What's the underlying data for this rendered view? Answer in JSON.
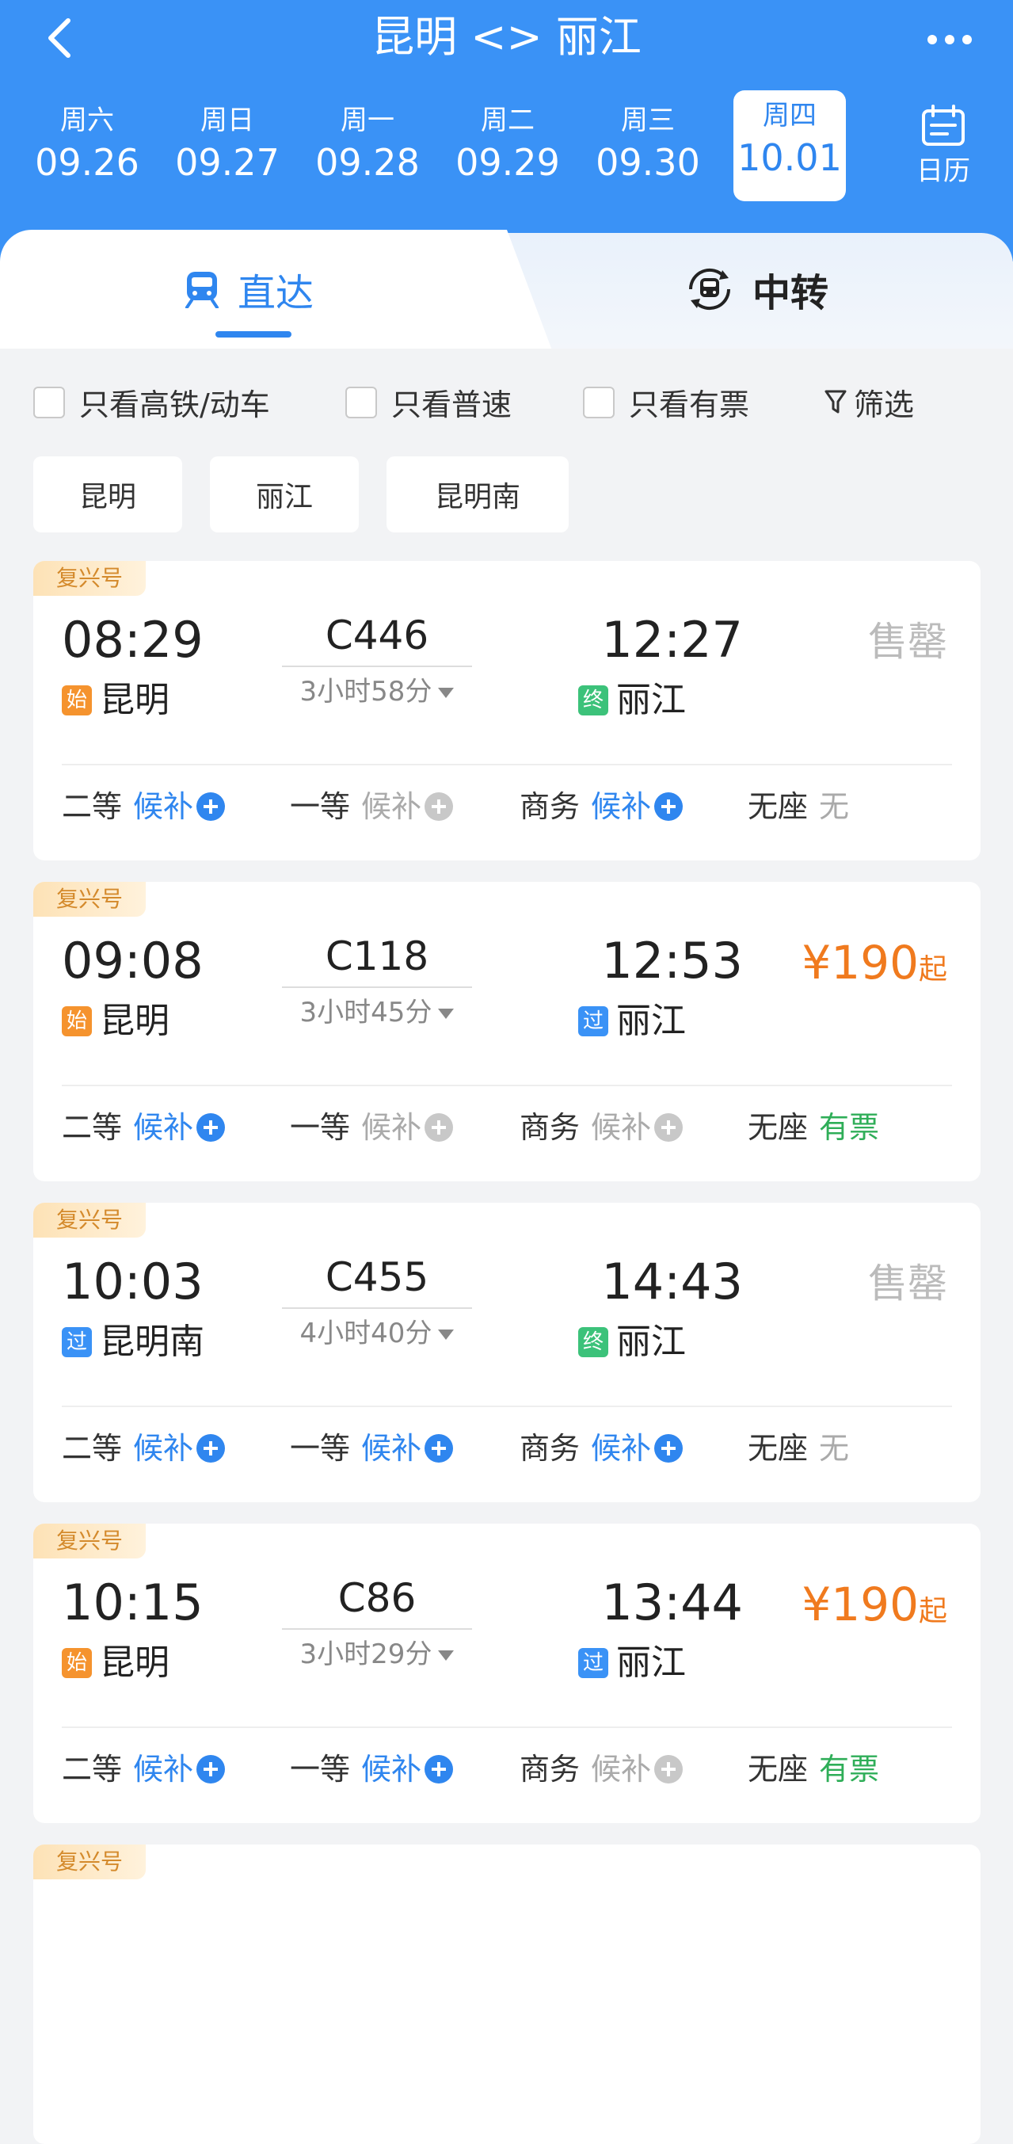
{
  "header": {
    "title": "昆明 <> 丽江",
    "dates": [
      {
        "weekday": "周六",
        "date": "09.26"
      },
      {
        "weekday": "周日",
        "date": "09.27"
      },
      {
        "weekday": "周一",
        "date": "09.28"
      },
      {
        "weekday": "周二",
        "date": "09.29"
      },
      {
        "weekday": "周三",
        "date": "09.30"
      },
      {
        "weekday": "周四",
        "date": "10.01"
      }
    ],
    "calendar_label": "日历"
  },
  "tabs": {
    "direct": "直达",
    "transfer": "中转"
  },
  "filters": {
    "high_speed": "只看高铁/动车",
    "normal": "只看普速",
    "available": "只看有票",
    "filter": "筛选"
  },
  "stations": [
    "昆明",
    "丽江",
    "昆明南"
  ],
  "trains": [
    {
      "badge": "复兴号",
      "dep_time": "08:29",
      "train_no": "C446",
      "duration": "3小时58分",
      "arr_time": "12:27",
      "from_tag": "始",
      "from": "昆明",
      "to_tag": "终",
      "to": "丽江",
      "price": "",
      "price_suffix": "",
      "status": "售罄",
      "seats": [
        {
          "class": "二等",
          "value": "候补"
        },
        {
          "class": "一等",
          "value": "候补"
        },
        {
          "class": "商务",
          "value": "候补"
        },
        {
          "class": "无座",
          "value": "无"
        }
      ]
    },
    {
      "badge": "复兴号",
      "dep_time": "09:08",
      "train_no": "C118",
      "duration": "3小时45分",
      "arr_time": "12:53",
      "from_tag": "始",
      "from": "昆明",
      "to_tag": "过",
      "to": "丽江",
      "price": "¥190",
      "price_suffix": "起",
      "status": "",
      "seats": [
        {
          "class": "二等",
          "value": "候补"
        },
        {
          "class": "一等",
          "value": "候补"
        },
        {
          "class": "商务",
          "value": "候补"
        },
        {
          "class": "无座",
          "value": "有票"
        }
      ]
    },
    {
      "badge": "复兴号",
      "dep_time": "10:03",
      "train_no": "C455",
      "duration": "4小时40分",
      "arr_time": "14:43",
      "from_tag": "过",
      "from": "昆明南",
      "to_tag": "终",
      "to": "丽江",
      "price": "",
      "price_suffix": "",
      "status": "售罄",
      "seats": [
        {
          "class": "二等",
          "value": "候补"
        },
        {
          "class": "一等",
          "value": "候补"
        },
        {
          "class": "商务",
          "value": "候补"
        },
        {
          "class": "无座",
          "value": "无"
        }
      ]
    },
    {
      "badge": "复兴号",
      "dep_time": "10:15",
      "train_no": "C86",
      "duration": "3小时29分",
      "arr_time": "13:44",
      "from_tag": "始",
      "from": "昆明",
      "to_tag": "过",
      "to": "丽江",
      "price": "¥190",
      "price_suffix": "起",
      "status": "",
      "seats": [
        {
          "class": "二等",
          "value": "候补"
        },
        {
          "class": "一等",
          "value": "候补"
        },
        {
          "class": "商务",
          "value": "候补"
        },
        {
          "class": "无座",
          "value": "有票"
        }
      ]
    },
    {
      "badge": "复兴号"
    }
  ]
}
